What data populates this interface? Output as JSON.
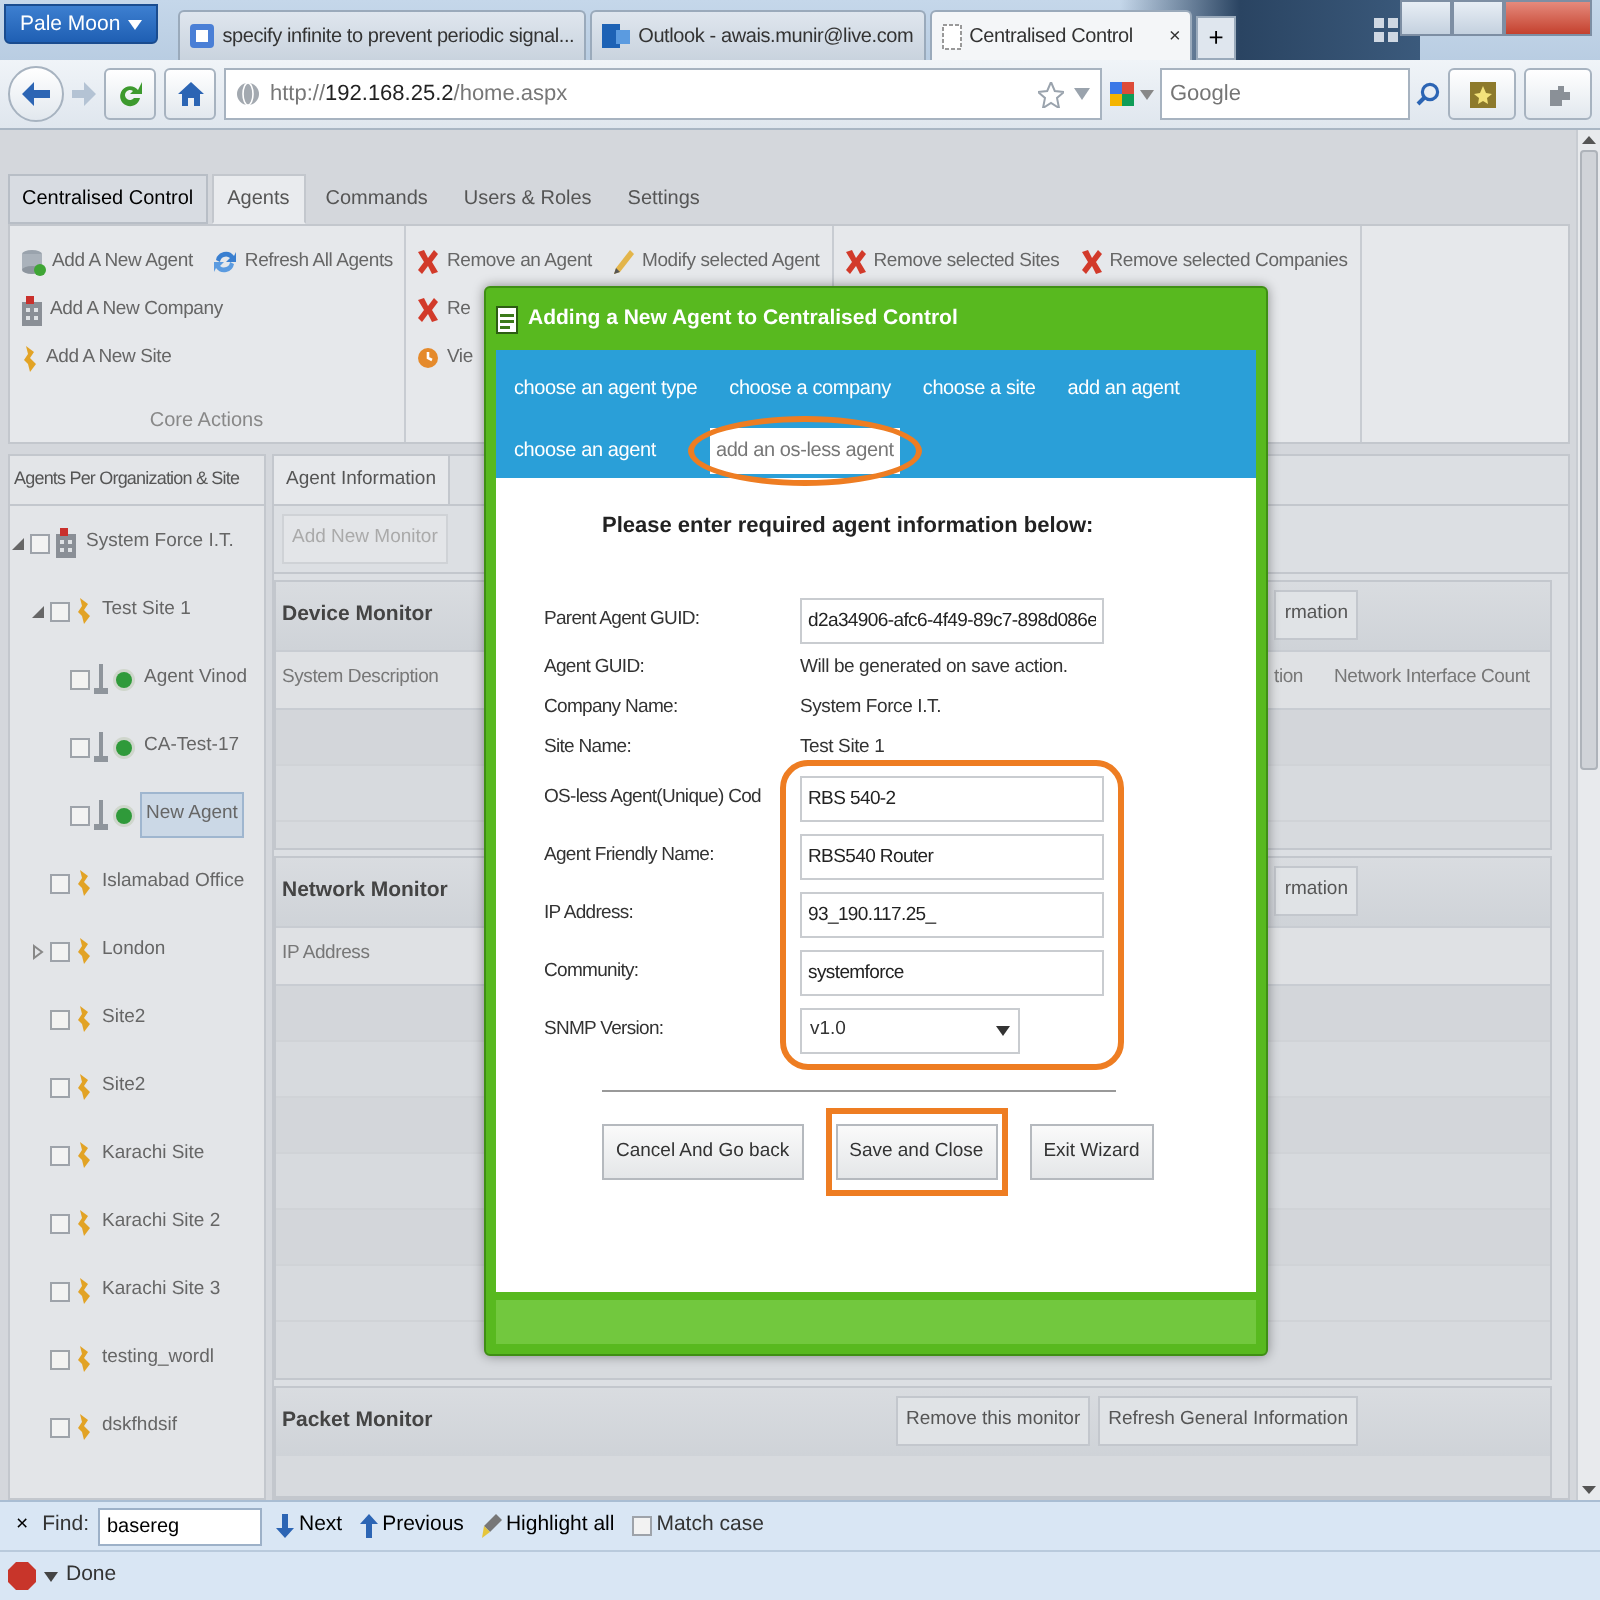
{
  "browser": {
    "menu_button": "Pale Moon",
    "tabs": [
      {
        "title": "specify infinite to prevent periodic signal...",
        "kind": "search",
        "selected": false
      },
      {
        "title": "Outlook - awais.munir@live.com",
        "kind": "mail",
        "selected": false
      },
      {
        "title": "Centralised Control",
        "kind": "page",
        "selected": true,
        "close": "×"
      }
    ],
    "new_tab": "+",
    "address": "http://**192.168.25.2**/home.aspx",
    "search": {
      "placeholder": "Google"
    }
  },
  "ribbon": {
    "app_button": "Centralised Control",
    "tabs": [
      {
        "label": "Agents",
        "selected": true
      },
      {
        "label": "Commands",
        "selected": false
      },
      {
        "label": "Users & Roles",
        "selected": false
      },
      {
        "label": "Settings",
        "selected": false
      }
    ],
    "groups": [
      {
        "caption": "Core Actions",
        "rows": [
          [
            {
              "label": "Add A New Agent",
              "kind": "add-agent"
            },
            {
              "label": "Refresh All Agents",
              "kind": "refresh"
            }
          ],
          [
            {
              "label": "Add A New Company",
              "kind": "add-company"
            }
          ],
          [
            {
              "label": "Add A New Site",
              "kind": "add-site"
            }
          ]
        ]
      },
      {
        "rows": [
          [
            {
              "label": "Remove an Agent",
              "kind": "remove"
            },
            {
              "label": "Modify selected Agent",
              "kind": "modify"
            }
          ],
          [
            {
              "label": "Re",
              "kind": "remove"
            }
          ],
          [
            {
              "label": "Vie",
              "kind": "view"
            }
          ]
        ]
      },
      {
        "rows": [
          [
            {
              "label": "Remove selected Sites",
              "kind": "remove"
            },
            {
              "label": "Remove selected Companies",
              "kind": "remove"
            }
          ]
        ]
      }
    ]
  },
  "tree": {
    "header": "Agents Per Organization & Site",
    "items": [
      {
        "label": "System Force I.T.",
        "kind": "company",
        "checked": false,
        "selected": false,
        "expanded": true,
        "children": [
          {
            "label": "Test Site 1",
            "kind": "site",
            "checked": false,
            "selected": false,
            "expanded": true,
            "children": [
              {
                "label": "Agent Vinod",
                "kind": "agent",
                "checked": false,
                "selected": false
              },
              {
                "label": "CA-Test-17",
                "kind": "agent",
                "checked": false,
                "selected": false
              },
              {
                "label": "New Agent",
                "kind": "agent",
                "checked": false,
                "selected": true
              }
            ]
          },
          {
            "label": "Islamabad Office",
            "kind": "site",
            "checked": false,
            "selected": false
          },
          {
            "label": "London",
            "kind": "site",
            "checked": false,
            "selected": false,
            "expanded": false
          },
          {
            "label": "Site2",
            "kind": "site",
            "checked": false,
            "selected": false
          },
          {
            "label": "Site2",
            "kind": "site",
            "checked": false,
            "selected": false
          },
          {
            "label": "Karachi Site",
            "kind": "site",
            "checked": false,
            "selected": false
          },
          {
            "label": "Karachi Site 2",
            "kind": "site",
            "checked": false,
            "selected": false
          },
          {
            "label": "Karachi Site 3",
            "kind": "site",
            "checked": false,
            "selected": false
          },
          {
            "label": "testing_wordl",
            "kind": "site",
            "checked": false,
            "selected": false
          },
          {
            "label": "dskfhdsif",
            "kind": "site",
            "checked": false,
            "selected": false
          }
        ]
      }
    ]
  },
  "agent_panel": {
    "tab": "Agent Information",
    "toolbar_button": {
      "label": "Add New Monitor",
      "disabled": true
    },
    "sections": [
      {
        "title": "Device Monitor",
        "buttons": [
          "rmation"
        ],
        "columns": [
          "System Description",
          "tion",
          "Network Interface Count"
        ]
      },
      {
        "title": "Network Monitor",
        "buttons": [
          "rmation"
        ],
        "columns": [
          "IP Address"
        ]
      },
      {
        "title": "Packet Monitor",
        "buttons": [
          "Remove this monitor",
          "Refresh General Information"
        ]
      }
    ]
  },
  "dialog": {
    "title": "Adding a New Agent to Centralised Control",
    "steps": [
      {
        "label": "choose an agent type",
        "selected": false,
        "highlighted": false
      },
      {
        "label": "choose a company",
        "selected": false,
        "highlighted": false
      },
      {
        "label": "choose a site",
        "selected": false,
        "highlighted": false
      },
      {
        "label": "add an agent",
        "selected": false,
        "highlighted": false
      },
      {
        "label": "choose an agent",
        "selected": false,
        "highlighted": false
      },
      {
        "label": "add an os-less agent",
        "selected": true,
        "highlighted": true
      }
    ],
    "heading": "Please enter required agent information below:",
    "fields": [
      {
        "label": "Parent Agent GUID:",
        "kind": "input",
        "value": "d2a34906-afc6-4f49-89c7-898d086e",
        "highlighted": false
      },
      {
        "label": "Agent GUID:",
        "kind": "text",
        "value": "Will be generated on save action.",
        "highlighted": false
      },
      {
        "label": "Company Name:",
        "kind": "text",
        "value": "System Force I.T.",
        "highlighted": false
      },
      {
        "label": "Site Name:",
        "kind": "text",
        "value": "Test Site 1",
        "highlighted": false
      },
      {
        "label": "OS-less Agent(Unique) Cod",
        "kind": "input",
        "value": "RBS 540-2",
        "highlighted": true
      },
      {
        "label": "Agent Friendly Name:",
        "kind": "input",
        "value": "RBS540 Router",
        "highlighted": true
      },
      {
        "label": "IP Address:",
        "kind": "input",
        "value": "93_190.117.25_",
        "highlighted": true
      },
      {
        "label": "Community:",
        "kind": "input",
        "value": "systemforce",
        "highlighted": true
      },
      {
        "label": "SNMP Version:",
        "kind": "select",
        "value": "v1.0",
        "highlighted": true
      }
    ],
    "buttons": [
      {
        "label": "Cancel And Go back",
        "highlighted": false
      },
      {
        "label": "Save and Close",
        "highlighted": true
      },
      {
        "label": "Exit Wizard",
        "highlighted": false
      }
    ]
  },
  "find_bar": {
    "close": "×",
    "label": "Find:",
    "value": "basereg",
    "next": "Next",
    "previous": "Previous",
    "highlight_all": "Highlight all",
    "match_case": {
      "label": "Match case",
      "checked": false
    }
  },
  "status_bar": {
    "text": "Done"
  }
}
